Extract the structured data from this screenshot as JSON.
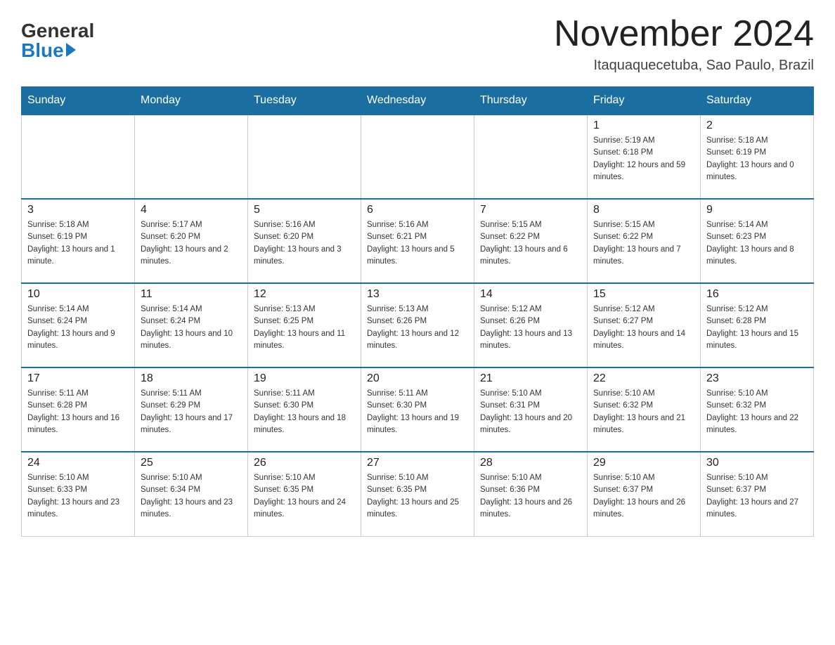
{
  "logo": {
    "general": "General",
    "blue": "Blue"
  },
  "header": {
    "month_year": "November 2024",
    "location": "Itaquaquecetuba, Sao Paulo, Brazil"
  },
  "days_of_week": [
    "Sunday",
    "Monday",
    "Tuesday",
    "Wednesday",
    "Thursday",
    "Friday",
    "Saturday"
  ],
  "weeks": [
    [
      {
        "day": "",
        "sunrise": "",
        "sunset": "",
        "daylight": ""
      },
      {
        "day": "",
        "sunrise": "",
        "sunset": "",
        "daylight": ""
      },
      {
        "day": "",
        "sunrise": "",
        "sunset": "",
        "daylight": ""
      },
      {
        "day": "",
        "sunrise": "",
        "sunset": "",
        "daylight": ""
      },
      {
        "day": "",
        "sunrise": "",
        "sunset": "",
        "daylight": ""
      },
      {
        "day": "1",
        "sunrise": "Sunrise: 5:19 AM",
        "sunset": "Sunset: 6:18 PM",
        "daylight": "Daylight: 12 hours and 59 minutes."
      },
      {
        "day": "2",
        "sunrise": "Sunrise: 5:18 AM",
        "sunset": "Sunset: 6:19 PM",
        "daylight": "Daylight: 13 hours and 0 minutes."
      }
    ],
    [
      {
        "day": "3",
        "sunrise": "Sunrise: 5:18 AM",
        "sunset": "Sunset: 6:19 PM",
        "daylight": "Daylight: 13 hours and 1 minute."
      },
      {
        "day": "4",
        "sunrise": "Sunrise: 5:17 AM",
        "sunset": "Sunset: 6:20 PM",
        "daylight": "Daylight: 13 hours and 2 minutes."
      },
      {
        "day": "5",
        "sunrise": "Sunrise: 5:16 AM",
        "sunset": "Sunset: 6:20 PM",
        "daylight": "Daylight: 13 hours and 3 minutes."
      },
      {
        "day": "6",
        "sunrise": "Sunrise: 5:16 AM",
        "sunset": "Sunset: 6:21 PM",
        "daylight": "Daylight: 13 hours and 5 minutes."
      },
      {
        "day": "7",
        "sunrise": "Sunrise: 5:15 AM",
        "sunset": "Sunset: 6:22 PM",
        "daylight": "Daylight: 13 hours and 6 minutes."
      },
      {
        "day": "8",
        "sunrise": "Sunrise: 5:15 AM",
        "sunset": "Sunset: 6:22 PM",
        "daylight": "Daylight: 13 hours and 7 minutes."
      },
      {
        "day": "9",
        "sunrise": "Sunrise: 5:14 AM",
        "sunset": "Sunset: 6:23 PM",
        "daylight": "Daylight: 13 hours and 8 minutes."
      }
    ],
    [
      {
        "day": "10",
        "sunrise": "Sunrise: 5:14 AM",
        "sunset": "Sunset: 6:24 PM",
        "daylight": "Daylight: 13 hours and 9 minutes."
      },
      {
        "day": "11",
        "sunrise": "Sunrise: 5:14 AM",
        "sunset": "Sunset: 6:24 PM",
        "daylight": "Daylight: 13 hours and 10 minutes."
      },
      {
        "day": "12",
        "sunrise": "Sunrise: 5:13 AM",
        "sunset": "Sunset: 6:25 PM",
        "daylight": "Daylight: 13 hours and 11 minutes."
      },
      {
        "day": "13",
        "sunrise": "Sunrise: 5:13 AM",
        "sunset": "Sunset: 6:26 PM",
        "daylight": "Daylight: 13 hours and 12 minutes."
      },
      {
        "day": "14",
        "sunrise": "Sunrise: 5:12 AM",
        "sunset": "Sunset: 6:26 PM",
        "daylight": "Daylight: 13 hours and 13 minutes."
      },
      {
        "day": "15",
        "sunrise": "Sunrise: 5:12 AM",
        "sunset": "Sunset: 6:27 PM",
        "daylight": "Daylight: 13 hours and 14 minutes."
      },
      {
        "day": "16",
        "sunrise": "Sunrise: 5:12 AM",
        "sunset": "Sunset: 6:28 PM",
        "daylight": "Daylight: 13 hours and 15 minutes."
      }
    ],
    [
      {
        "day": "17",
        "sunrise": "Sunrise: 5:11 AM",
        "sunset": "Sunset: 6:28 PM",
        "daylight": "Daylight: 13 hours and 16 minutes."
      },
      {
        "day": "18",
        "sunrise": "Sunrise: 5:11 AM",
        "sunset": "Sunset: 6:29 PM",
        "daylight": "Daylight: 13 hours and 17 minutes."
      },
      {
        "day": "19",
        "sunrise": "Sunrise: 5:11 AM",
        "sunset": "Sunset: 6:30 PM",
        "daylight": "Daylight: 13 hours and 18 minutes."
      },
      {
        "day": "20",
        "sunrise": "Sunrise: 5:11 AM",
        "sunset": "Sunset: 6:30 PM",
        "daylight": "Daylight: 13 hours and 19 minutes."
      },
      {
        "day": "21",
        "sunrise": "Sunrise: 5:10 AM",
        "sunset": "Sunset: 6:31 PM",
        "daylight": "Daylight: 13 hours and 20 minutes."
      },
      {
        "day": "22",
        "sunrise": "Sunrise: 5:10 AM",
        "sunset": "Sunset: 6:32 PM",
        "daylight": "Daylight: 13 hours and 21 minutes."
      },
      {
        "day": "23",
        "sunrise": "Sunrise: 5:10 AM",
        "sunset": "Sunset: 6:32 PM",
        "daylight": "Daylight: 13 hours and 22 minutes."
      }
    ],
    [
      {
        "day": "24",
        "sunrise": "Sunrise: 5:10 AM",
        "sunset": "Sunset: 6:33 PM",
        "daylight": "Daylight: 13 hours and 23 minutes."
      },
      {
        "day": "25",
        "sunrise": "Sunrise: 5:10 AM",
        "sunset": "Sunset: 6:34 PM",
        "daylight": "Daylight: 13 hours and 23 minutes."
      },
      {
        "day": "26",
        "sunrise": "Sunrise: 5:10 AM",
        "sunset": "Sunset: 6:35 PM",
        "daylight": "Daylight: 13 hours and 24 minutes."
      },
      {
        "day": "27",
        "sunrise": "Sunrise: 5:10 AM",
        "sunset": "Sunset: 6:35 PM",
        "daylight": "Daylight: 13 hours and 25 minutes."
      },
      {
        "day": "28",
        "sunrise": "Sunrise: 5:10 AM",
        "sunset": "Sunset: 6:36 PM",
        "daylight": "Daylight: 13 hours and 26 minutes."
      },
      {
        "day": "29",
        "sunrise": "Sunrise: 5:10 AM",
        "sunset": "Sunset: 6:37 PM",
        "daylight": "Daylight: 13 hours and 26 minutes."
      },
      {
        "day": "30",
        "sunrise": "Sunrise: 5:10 AM",
        "sunset": "Sunset: 6:37 PM",
        "daylight": "Daylight: 13 hours and 27 minutes."
      }
    ]
  ]
}
